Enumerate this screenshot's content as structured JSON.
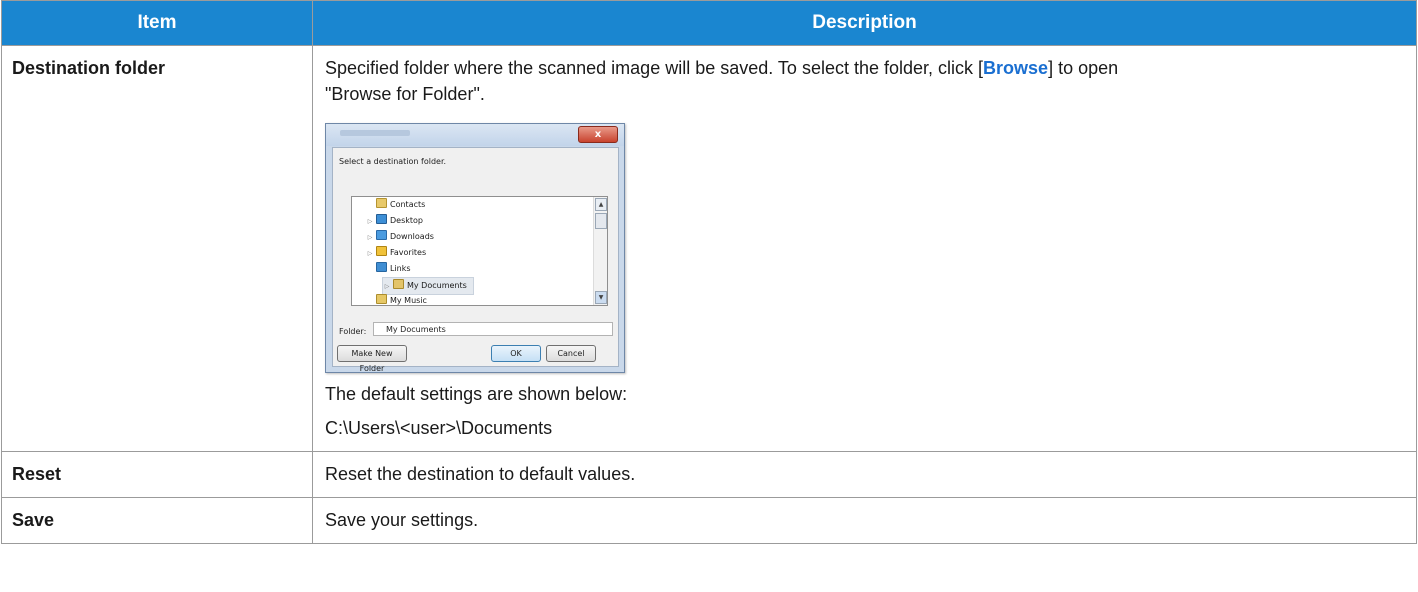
{
  "table": {
    "headers": {
      "item": "Item",
      "description": "Description"
    },
    "rows": [
      {
        "item": "Destination folder",
        "desc_text_1": "Specified folder where the scanned image will be saved. To select the folder, click [",
        "desc_keyword": "Browse",
        "desc_text_2": "] to open",
        "desc_text_3": "\"Browse for Folder\".",
        "default_label": "The default settings are shown below:",
        "default_value": "C:\\Users\\<user>\\Documents"
      },
      {
        "item": "Reset",
        "description": "Reset the destination to default values."
      },
      {
        "item": "Save",
        "description": "Save your settings."
      }
    ]
  },
  "dialog": {
    "close_label": "x",
    "prompt": "Select a destination folder.",
    "tree_items": [
      {
        "label": "Contacts",
        "icon": "contacts-folder-icon",
        "expandable": false
      },
      {
        "label": "Desktop",
        "icon": "desktop-folder-icon",
        "expandable": true
      },
      {
        "label": "Downloads",
        "icon": "downloads-folder-icon",
        "expandable": true
      },
      {
        "label": "Favorites",
        "icon": "favorites-folder-icon",
        "expandable": true
      },
      {
        "label": "Links",
        "icon": "links-folder-icon",
        "expandable": false
      },
      {
        "label": "My Documents",
        "icon": "documents-folder-icon",
        "expandable": true,
        "selected": true
      },
      {
        "label": "My Music",
        "icon": "music-folder-icon",
        "expandable": false
      }
    ],
    "folder_label": "Folder:",
    "folder_value": "My Documents",
    "make_new_folder_label": "Make New Folder",
    "ok_label": "OK",
    "cancel_label": "Cancel"
  },
  "colors": {
    "header_bg": "#1a86d0",
    "keyword": "#1a6fd1",
    "border": "#9b9b9b"
  }
}
